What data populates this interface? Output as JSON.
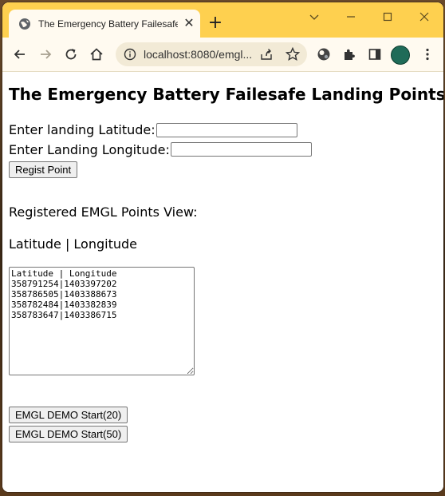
{
  "browser": {
    "tab_title": "The Emergency Battery Failesafe Landing Points",
    "url": "localhost:8080/emgl..."
  },
  "page": {
    "title": "The Emergency Battery Failesafe Landing Points",
    "latitude_label": "Enter landing Latitude:",
    "longitude_label": "Enter Landing Longitude:",
    "latitude_value": "",
    "longitude_value": "",
    "regist_button": "Regist Point",
    "registered_view_label": "Registered EMGL Points View:",
    "columns_label": "Latitude | Longitude",
    "points_text": "Latitude | Longitude\n358791254|1403397202\n358786505|1403388673\n358782484|1403382839\n358783647|1403386715",
    "demo_button_20": "EMGL DEMO Start(20)",
    "demo_button_50": "EMGL DEMO Start(50)"
  },
  "colors": {
    "tabstrip": "#fed04f",
    "toolbar": "#fffaf0"
  },
  "icons": [
    "globe-icon",
    "close-icon",
    "plus-icon",
    "chevron-down-icon",
    "minimize-icon",
    "maximize-icon",
    "close-window-icon",
    "back-icon",
    "forward-icon",
    "reload-icon",
    "home-icon",
    "info-icon",
    "share-icon",
    "star-icon",
    "extension-globe-icon",
    "puzzle-icon",
    "side-panel-icon",
    "avatar",
    "more-icon"
  ]
}
